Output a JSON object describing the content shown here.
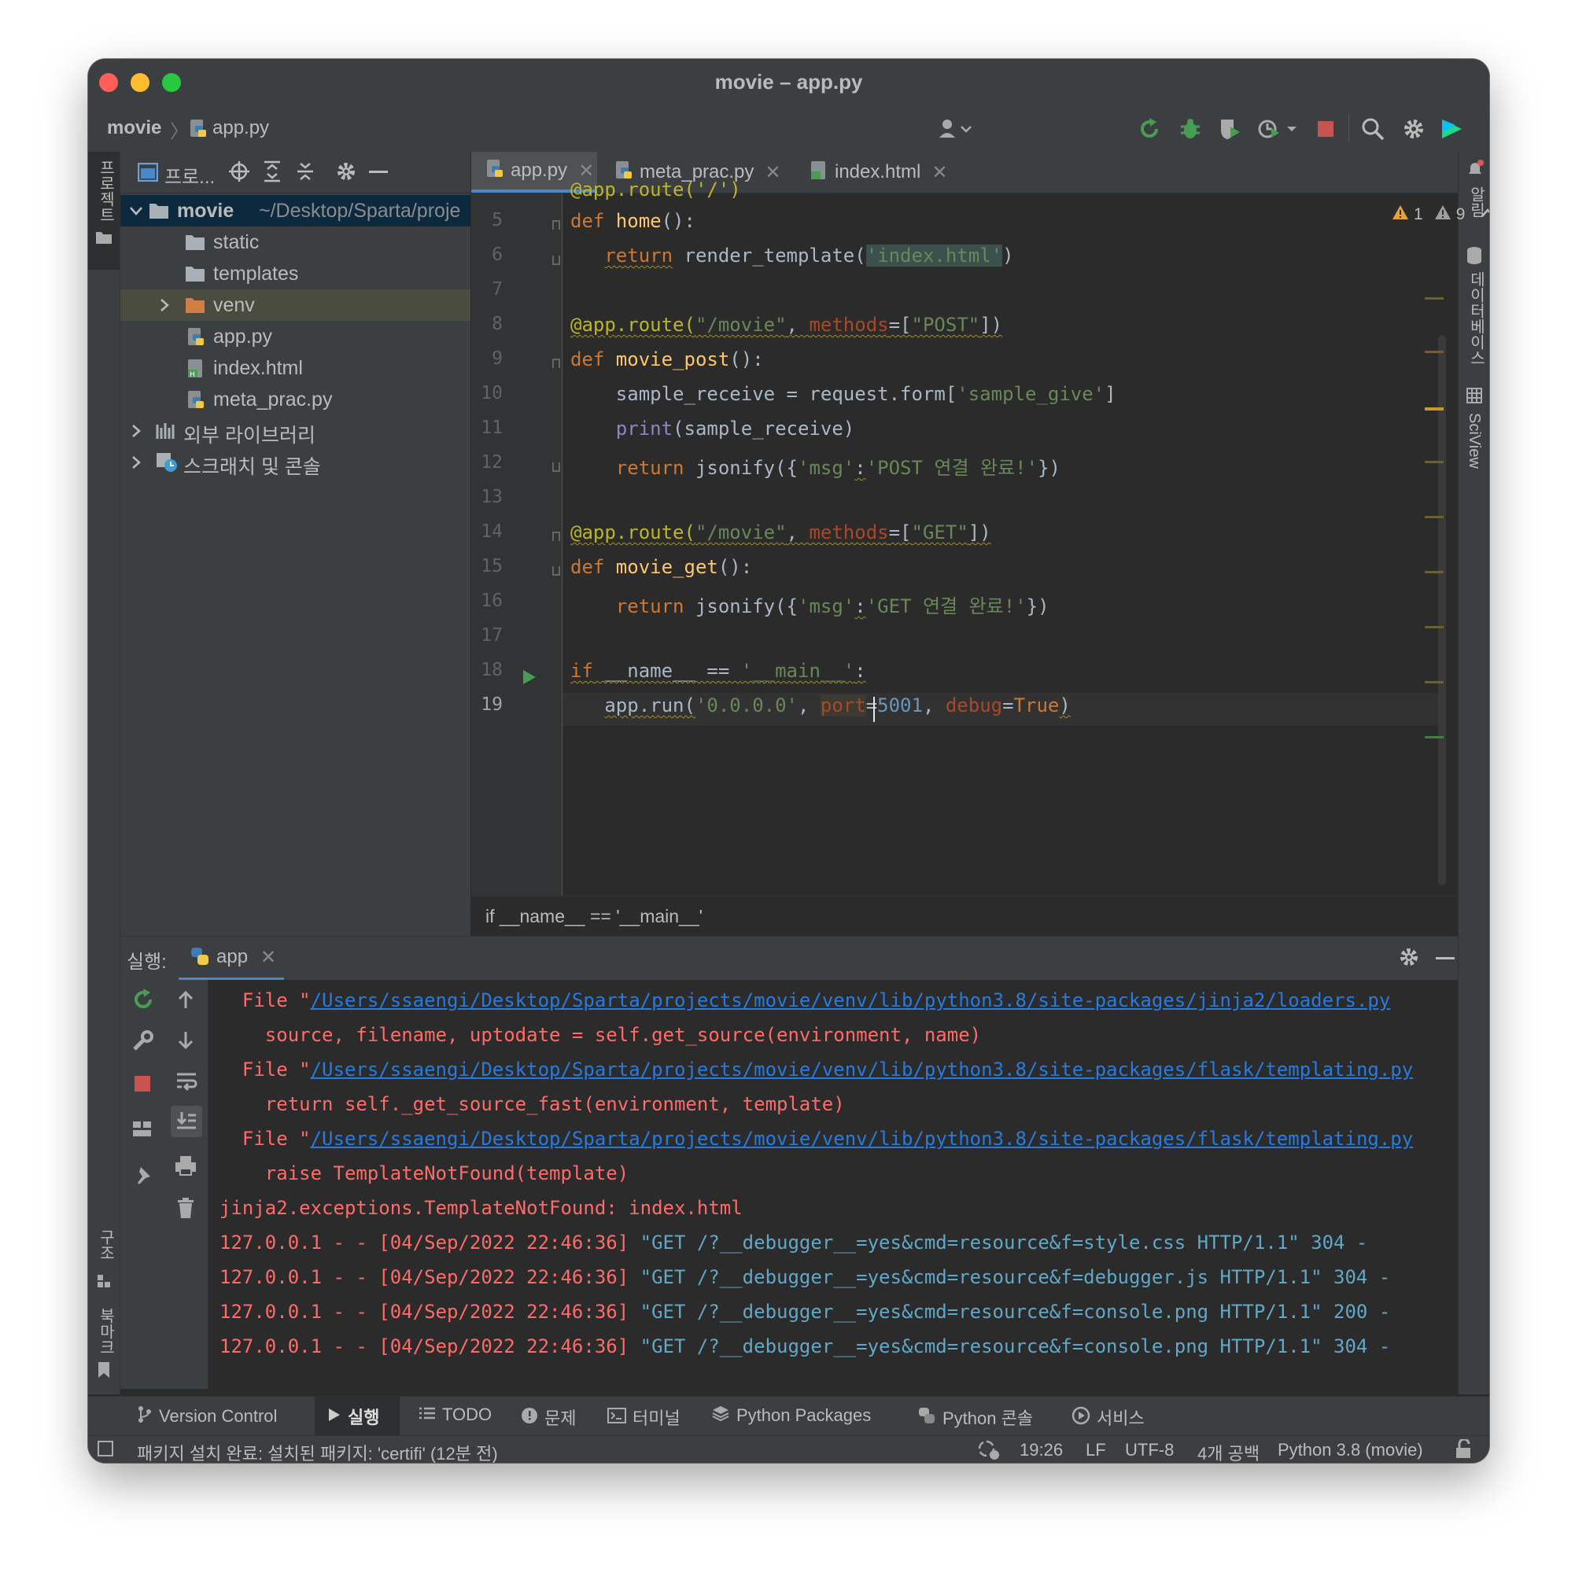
{
  "window": {
    "title": "movie – app.py"
  },
  "nav": {
    "project": "movie",
    "file": "app.py",
    "run_config": "app"
  },
  "project_panel": {
    "title": "프로...",
    "root_name": "movie",
    "root_path": "~/Desktop/Sparta/proje",
    "items": [
      "static",
      "templates",
      "venv",
      "app.py",
      "index.html",
      "meta_prac.py"
    ],
    "external_libraries": "외부 라이브러리",
    "scratches": "스크래치 및 콘솔"
  },
  "left_stripe": {
    "project": "프로젝트",
    "structure": "구조",
    "bookmarks": "북마크"
  },
  "right_stripe": {
    "notifications": "알림",
    "database": "데이터베이스",
    "sciview": "SciView"
  },
  "tabs": [
    "app.py",
    "meta_prac.py",
    "index.html"
  ],
  "inspections": {
    "errors": "1",
    "warnings": "9"
  },
  "code": {
    "line_numbers": [
      "5",
      "6",
      "7",
      "8",
      "9",
      "10",
      "11",
      "12",
      "13",
      "14",
      "15",
      "16",
      "17",
      "18",
      "19"
    ],
    "partial_top": "@app.route('/')",
    "l5": {
      "kw": "def ",
      "fn": "home",
      "rest": "():"
    },
    "l6": {
      "kw": "return",
      "mid": " render_template(",
      "str": "'index.html'",
      "end": ")"
    },
    "l8": {
      "dec": "@app.route(",
      "str1": "\"/movie\"",
      "sep": ", ",
      "param": "methods",
      "eq": "=[",
      "str2": "\"POST\"",
      "end": "])"
    },
    "l9": {
      "kw": "def ",
      "fn": "movie_post",
      "rest": "():"
    },
    "l10": {
      "a": "sample_receive = request.form[",
      "str": "'sample_give'",
      "b": "]"
    },
    "l11": {
      "blt": "print",
      "rest": "(sample_receive)"
    },
    "l12": {
      "kw": "return",
      "a": " jsonify({",
      "s1": "'msg'",
      "b": ":",
      "s2": "'POST 연결 완료!'",
      "c": "})"
    },
    "l14": {
      "dec": "@app.route(",
      "str1": "\"/movie\"",
      "sep": ", ",
      "param": "methods",
      "eq": "=[",
      "str2": "\"GET\"",
      "end": "])"
    },
    "l15": {
      "kw": "def ",
      "fn": "movie_get",
      "rest": "():"
    },
    "l16": {
      "kw": "return",
      "a": " jsonify({",
      "s1": "'msg'",
      "b": ":",
      "s2": "'GET 연결 완료!'",
      "c": "})"
    },
    "l18": {
      "kw": "if",
      "a": " __name__ == ",
      "str": "'__main__'",
      "b": ":"
    },
    "l19": {
      "a": "app.run(",
      "s1": "'0.0.0.0'",
      "b": ", ",
      "p1": "port",
      "c": "=",
      "n1": "5001",
      "d": ", ",
      "p2": "debug",
      "e": "=",
      "k": "True",
      "f": ")"
    }
  },
  "editor_breadcrumb": "if __name__ == '__main__'",
  "run_panel": {
    "label": "실행:",
    "tab": "app"
  },
  "console": {
    "file_prefix": "File \"",
    "link1": "/Users/ssaengi/Desktop/Sparta/projects/movie/venv/lib/python3.8/site-packages/jinja2/loaders.py",
    "line1": "source, filename, uptodate = self.get_source(environment, name)",
    "link2": "/Users/ssaengi/Desktop/Sparta/projects/movie/venv/lib/python3.8/site-packages/flask/templating.py",
    "line2": "return self._get_source_fast(environment, template)",
    "link3": "/Users/ssaengi/Desktop/Sparta/projects/movie/venv/lib/python3.8/site-packages/flask/templating.py",
    "line3": "raise TemplateNotFound(template)",
    "exception": "jinja2.exceptions.TemplateNotFound: index.html",
    "logs": [
      {
        "prefix": "127.0.0.1 - - [04/Sep/2022 22:46:36] ",
        "req": "\"GET /?__debugger__=yes&cmd=resource&f=style.css HTTP/1.1\" 304 -"
      },
      {
        "prefix": "127.0.0.1 - - [04/Sep/2022 22:46:36] ",
        "req": "\"GET /?__debugger__=yes&cmd=resource&f=debugger.js HTTP/1.1\" 304 -"
      },
      {
        "prefix": "127.0.0.1 - - [04/Sep/2022 22:46:36] ",
        "req": "\"GET /?__debugger__=yes&cmd=resource&f=console.png HTTP/1.1\" 200 -"
      },
      {
        "prefix": "127.0.0.1 - - [04/Sep/2022 22:46:36] ",
        "req": "\"GET /?__debugger__=yes&cmd=resource&f=console.png HTTP/1.1\" 304 -"
      }
    ]
  },
  "tool_windows": [
    "Version Control",
    "실행",
    "TODO",
    "문제",
    "터미널",
    "Python Packages",
    "Python 콘솔",
    "서비스"
  ],
  "status": {
    "message": "패키지 설치 완료: 설치된 패키지: 'certifi' (12분 전)",
    "position": "19:26",
    "line_sep": "LF",
    "encoding": "UTF-8",
    "indent": "4개 공백",
    "interpreter": "Python 3.8 (movie)"
  },
  "colors": {
    "accent": "#4a88c7",
    "error": "#ff6b68",
    "link": "#287bde",
    "run_green": "#499c54",
    "stop_red": "#c75450"
  }
}
